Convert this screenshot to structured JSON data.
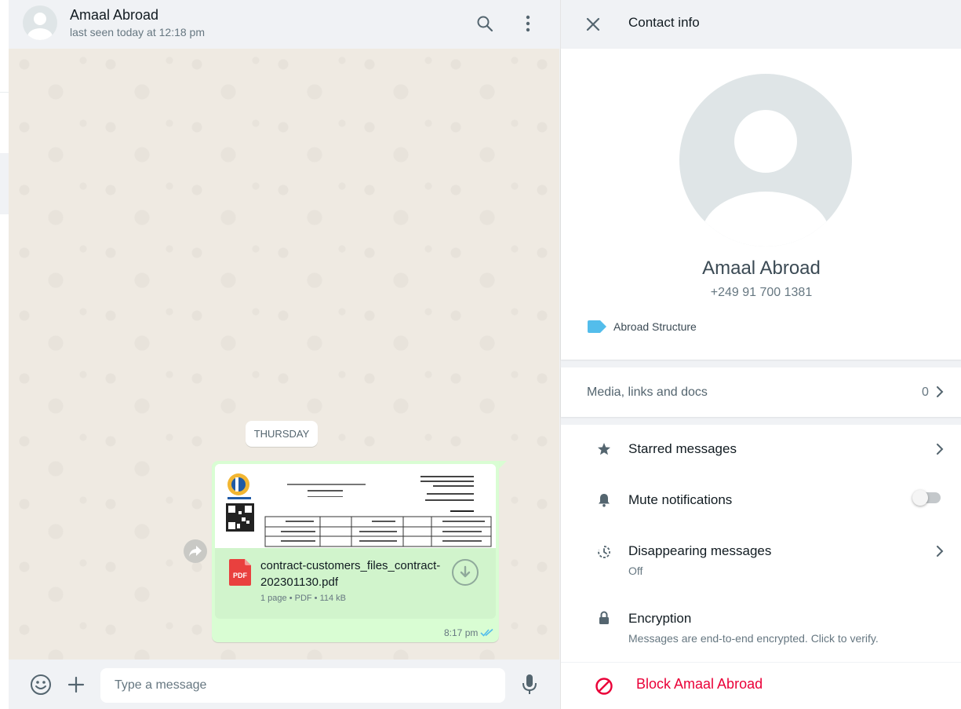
{
  "chat": {
    "contact_name": "Amaal Abroad",
    "last_seen": "last seen today at 12:18 pm",
    "day_label": "THURSDAY",
    "message": {
      "file_name": "contract-customers_files_contract-202301130.pdf",
      "file_meta": "1 page • PDF • 114 kB",
      "file_type": "PDF",
      "time": "8:17 pm"
    },
    "composer": {
      "placeholder": "Type a message"
    }
  },
  "info": {
    "title": "Contact info",
    "name": "Amaal Abroad",
    "phone": "+249 91 700 1381",
    "label": "Abroad Structure",
    "media_label": "Media, links and docs",
    "media_count": "0",
    "options": {
      "starred": "Starred messages",
      "mute": "Mute notifications",
      "disappearing": "Disappearing messages",
      "disappearing_value": "Off",
      "encryption": "Encryption",
      "encryption_sub": "Messages are end-to-end encrypted. Click to verify."
    },
    "block": "Block Amaal Abroad"
  },
  "colors": {
    "bubble": "#d9fdd3",
    "label_tag": "#53bdeb",
    "danger": "#ea0038",
    "tick": "#53bdeb"
  },
  "icons": [
    "search-icon",
    "menu-icon",
    "forward-icon",
    "pdf-icon",
    "download-icon",
    "double-check-icon",
    "emoji-icon",
    "plus-icon",
    "mic-icon",
    "close-icon",
    "label-icon",
    "chevron-right-icon",
    "star-icon",
    "bell-icon",
    "timer-icon",
    "lock-icon",
    "block-icon"
  ]
}
